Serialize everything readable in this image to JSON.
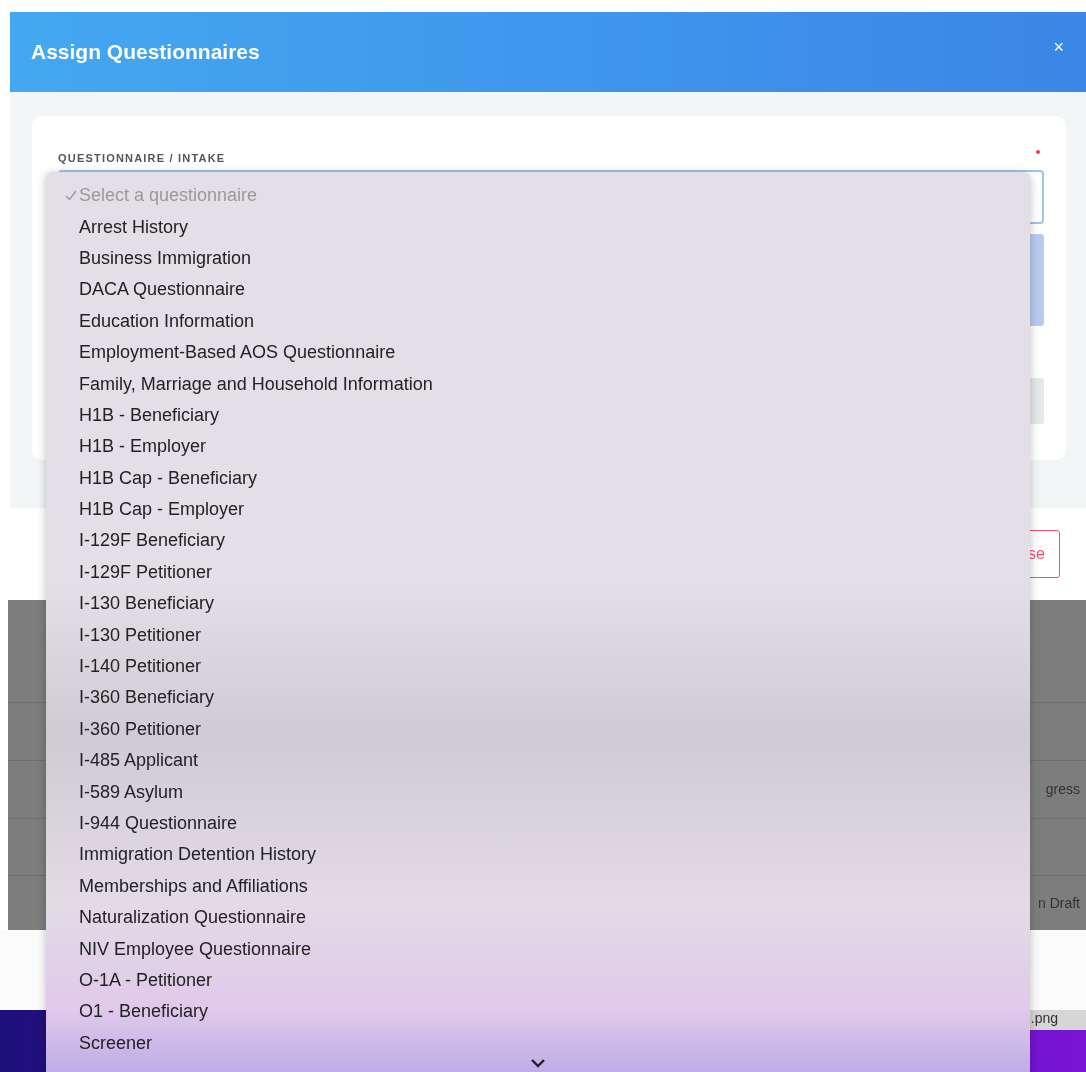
{
  "dialog": {
    "title": "Assign Questionnaires",
    "close": "×",
    "field_label": "QUESTIONNAIRE / INTAKE",
    "required": true,
    "footer_button": "se"
  },
  "dropdown": {
    "options": [
      {
        "label": "Select a questionnaire",
        "selected": true,
        "disabled": true
      },
      {
        "label": "Arrest History",
        "selected": false,
        "disabled": false
      },
      {
        "label": "Business Immigration",
        "selected": false,
        "disabled": false
      },
      {
        "label": "DACA Questionnaire",
        "selected": false,
        "disabled": false
      },
      {
        "label": "Education Information",
        "selected": false,
        "disabled": false
      },
      {
        "label": "Employment-Based AOS Questionnaire",
        "selected": false,
        "disabled": false
      },
      {
        "label": "Family, Marriage and Household Information",
        "selected": false,
        "disabled": false
      },
      {
        "label": "H1B - Beneficiary",
        "selected": false,
        "disabled": false
      },
      {
        "label": "H1B - Employer",
        "selected": false,
        "disabled": false
      },
      {
        "label": "H1B Cap - Beneficiary",
        "selected": false,
        "disabled": false
      },
      {
        "label": "H1B Cap - Employer",
        "selected": false,
        "disabled": false
      },
      {
        "label": "I-129F Beneficiary",
        "selected": false,
        "disabled": false
      },
      {
        "label": "I-129F Petitioner",
        "selected": false,
        "disabled": false
      },
      {
        "label": "I-130 Beneficiary",
        "selected": false,
        "disabled": false
      },
      {
        "label": "I-130 Petitioner",
        "selected": false,
        "disabled": false
      },
      {
        "label": "I-140 Petitioner",
        "selected": false,
        "disabled": false
      },
      {
        "label": "I-360 Beneficiary",
        "selected": false,
        "disabled": false
      },
      {
        "label": "I-360 Petitioner",
        "selected": false,
        "disabled": false
      },
      {
        "label": "I-485 Applicant",
        "selected": false,
        "disabled": false
      },
      {
        "label": "I-589 Asylum",
        "selected": false,
        "disabled": false
      },
      {
        "label": "I-944 Questionnaire",
        "selected": false,
        "disabled": false
      },
      {
        "label": "Immigration Detention History",
        "selected": false,
        "disabled": false
      },
      {
        "label": "Memberships and Affiliations",
        "selected": false,
        "disabled": false
      },
      {
        "label": "Naturalization Questionnaire",
        "selected": false,
        "disabled": false
      },
      {
        "label": "NIV Employee Questionnaire",
        "selected": false,
        "disabled": false
      },
      {
        "label": "O-1A - Petitioner",
        "selected": false,
        "disabled": false
      },
      {
        "label": "O1 - Beneficiary",
        "selected": false,
        "disabled": false
      },
      {
        "label": "Screener",
        "selected": false,
        "disabled": false
      }
    ]
  },
  "background": {
    "table_cells": [
      "gress",
      "n Draft"
    ],
    "file_label": ".png"
  }
}
